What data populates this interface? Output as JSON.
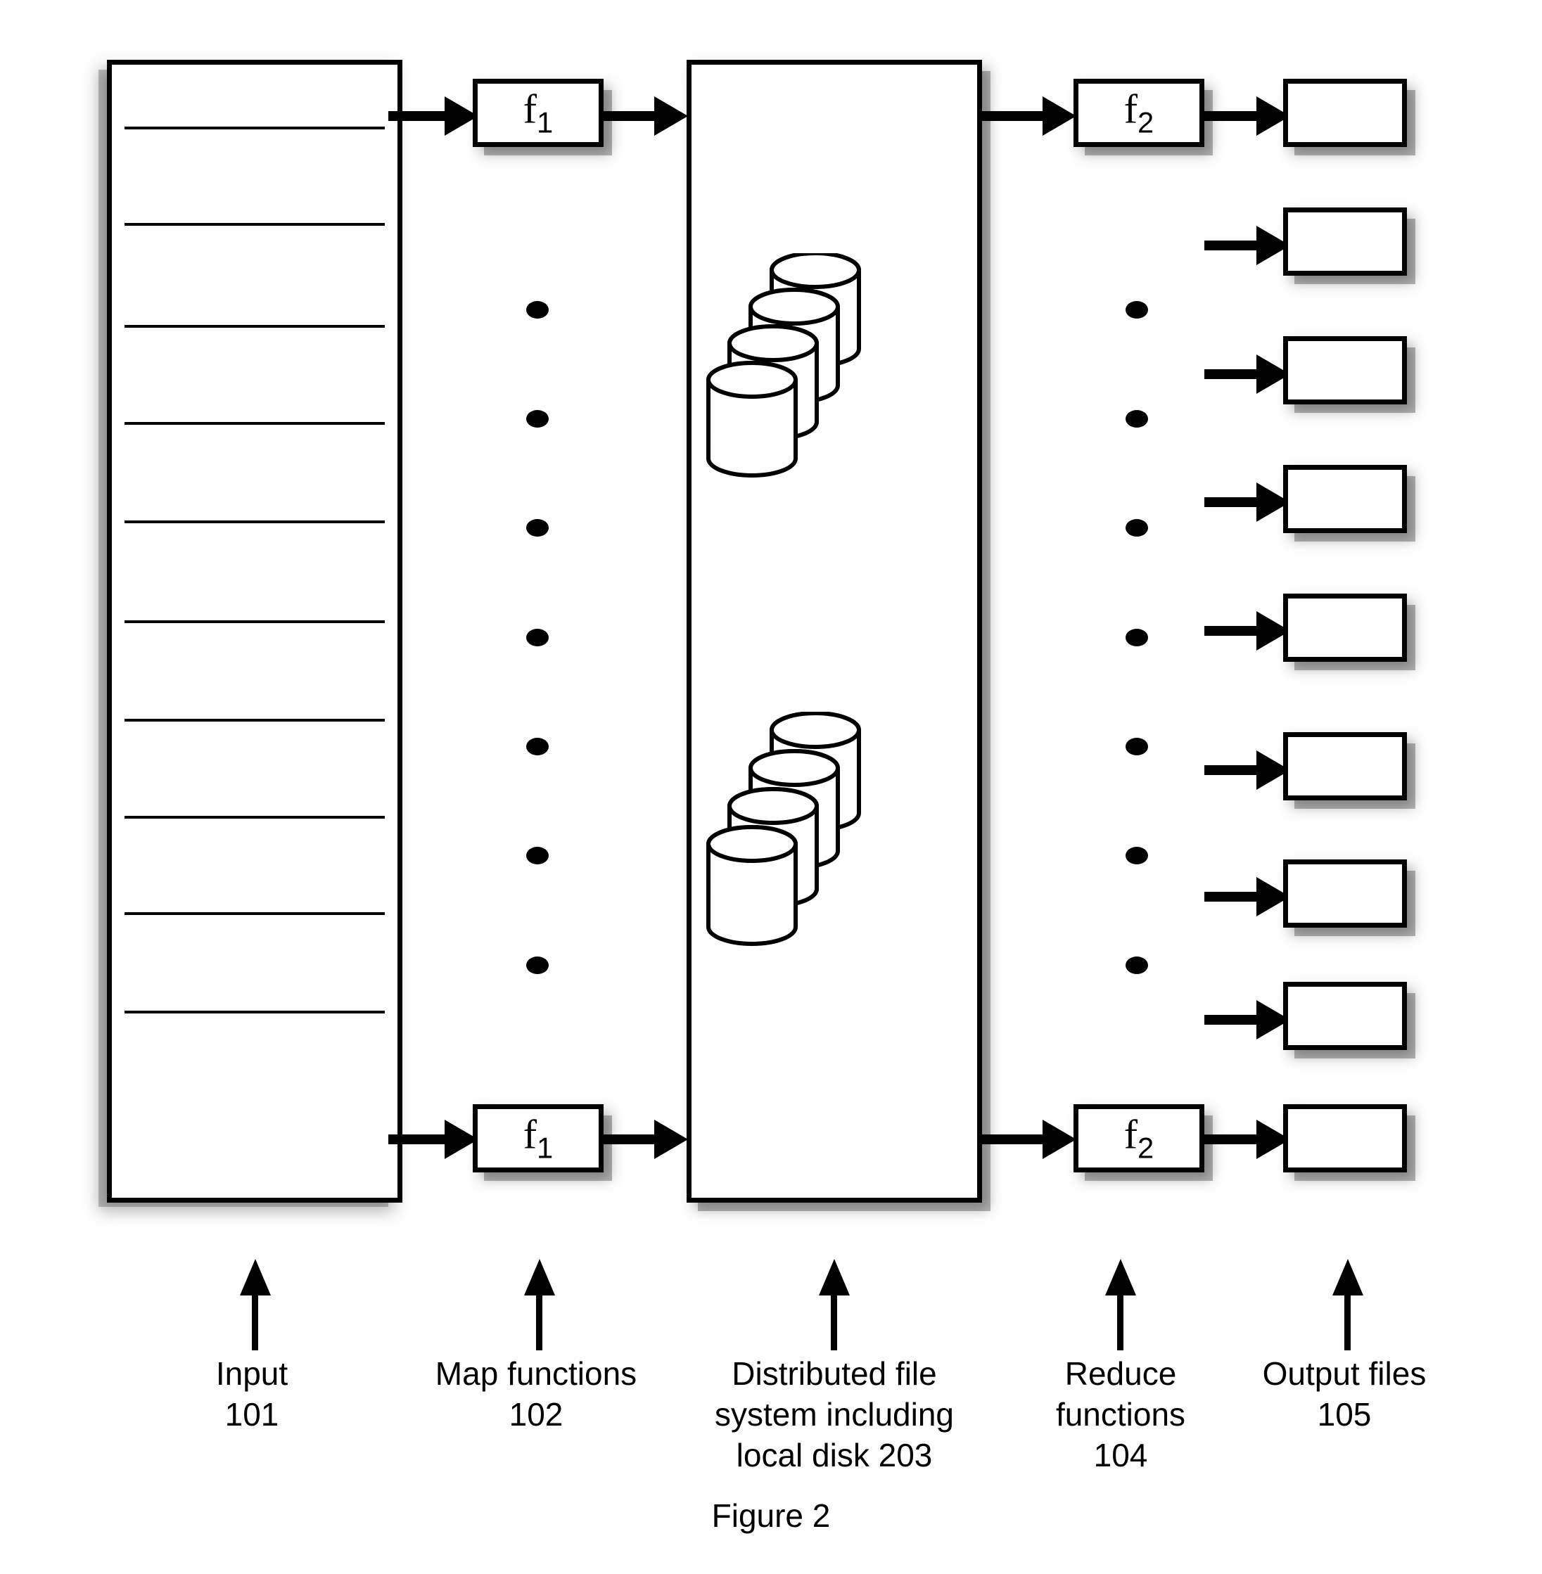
{
  "figure": {
    "title": "Figure 2"
  },
  "columns": [
    {
      "id": "input",
      "caption_line1": "Input",
      "caption_line2": "101"
    },
    {
      "id": "map-functions",
      "caption_line1": "Map functions",
      "caption_line2": "102"
    },
    {
      "id": "distributed-file-system",
      "caption_line1": "Distributed file",
      "caption_line2": "system including",
      "caption_line3": "local disk 203"
    },
    {
      "id": "reduce-functions",
      "caption_line1": "Reduce",
      "caption_line2": "functions",
      "caption_line3": "104"
    },
    {
      "id": "output-files",
      "caption_line1": "Output files",
      "caption_line2": "105"
    }
  ],
  "captions": {
    "input": "Input\n101",
    "map_functions": "Map functions\n102",
    "distributed_file_system": "Distributed file\nsystem including\nlocal disk 203",
    "reduce_functions": "Reduce\nfunctions\n104",
    "output_files": "Output files\n105"
  },
  "map_functions": {
    "top_label": "f",
    "top_label_sub": "1",
    "bottom_label": "f",
    "bottom_label_sub": "1",
    "ellipsis_dots": 7
  },
  "reduce_functions": {
    "top_label": "f",
    "top_label_sub": "2",
    "bottom_label": "f",
    "bottom_label_sub": "2",
    "ellipsis_dots": 7
  },
  "input_block": {
    "divider_lines": 10
  },
  "distributed_file_system": {
    "disk_stacks": 2,
    "disks_per_stack": 4
  },
  "output_files": {
    "count": 9
  },
  "colors": {
    "ink": "#000000",
    "paper": "#ffffff",
    "shadow": "rgba(0,0,0,0.30)"
  }
}
